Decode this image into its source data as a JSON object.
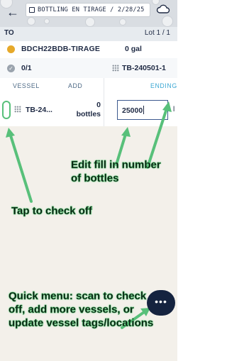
{
  "header": {
    "title": "BOTTLING EN TIRAGE / 2/28/25"
  },
  "to_row": {
    "label": "TO",
    "lot": "Lot 1 / 1"
  },
  "lot": {
    "name": "BDCH22BDB-TIRAGE",
    "volume": "0 gal"
  },
  "status": {
    "count": "0/1",
    "tag": "TB-240501-1"
  },
  "columns": {
    "vessel": "VESSEL",
    "add": "ADD",
    "ending": "ENDING"
  },
  "vessel_row": {
    "name": "TB-24...",
    "bottles_count": "0",
    "bottles_label": "bottles",
    "fill_value": "25000",
    "unit_fragment": "l"
  },
  "annotations": {
    "edit_fill": "Edit fill in number of bottles",
    "tap_check": "Tap to check off",
    "quick_menu": "Quick menu: scan to check off, add more vessels, or update vessel tags/locations"
  },
  "fab": {
    "label": "•••"
  },
  "colors": {
    "accent": "#3aa7d3",
    "annotation_green": "#58c07a",
    "fab_bg": "#15233f"
  }
}
